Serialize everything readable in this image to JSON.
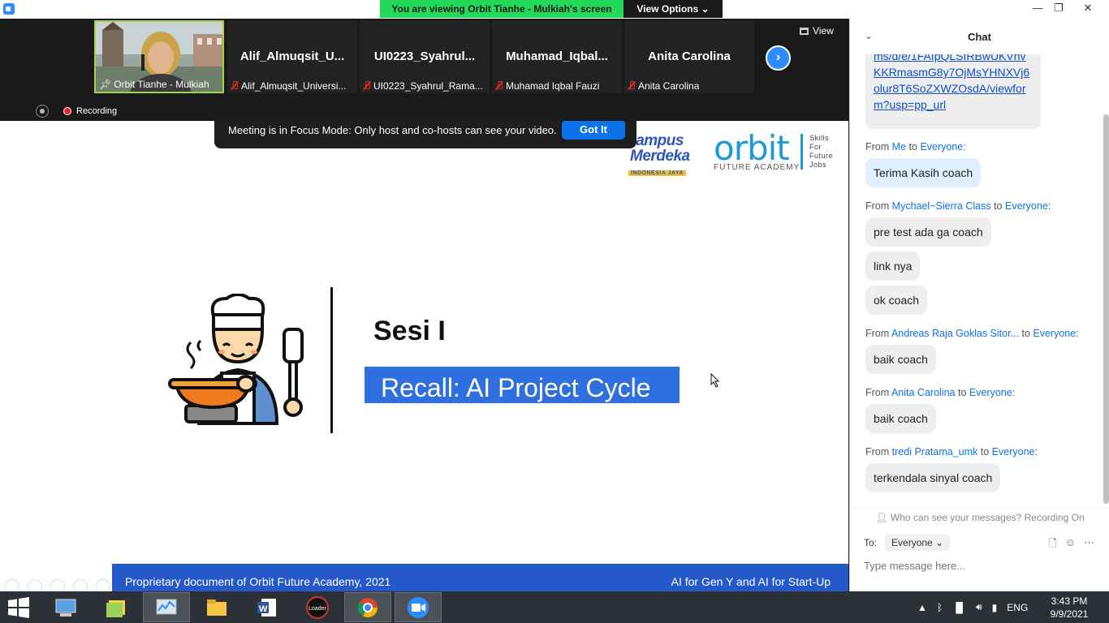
{
  "titlebar": {
    "viewing_banner": "You are viewing Orbit Tianhe - Mulkiah's screen",
    "view_options": "View Options",
    "minimize": "—",
    "restore": "❐",
    "close": "✕"
  },
  "strip": {
    "view_label": "View",
    "recording_label": "Recording",
    "participants": [
      {
        "label": "Orbit Tianhe - Mulkiah",
        "name": ""
      },
      {
        "label": "Alif_Almuqsit_Universi...",
        "name": "Alif_Almuqsit_U..."
      },
      {
        "label": "UI0223_Syahrul_Rama...",
        "name": "UI0223_Syahrul..."
      },
      {
        "label": "Muhamad Iqbal Fauzi",
        "name": "Muhamad_Iqbal..."
      },
      {
        "label": "Anita Carolina",
        "name": "Anita Carolina"
      }
    ]
  },
  "focus_toast": {
    "message": "Meeting is in Focus Mode: Only host and co-hosts can see your video.",
    "button": "Got It"
  },
  "slide": {
    "kampus_line1": "Kampus",
    "kampus_line2": "Merdeka",
    "kampus_line3": "INDONESIA JAYA",
    "orbit_word": "orbit",
    "orbit_sub": "FUTURE ACADEMY",
    "skills_lines": [
      "Skills",
      "For",
      "Future",
      "Jobs"
    ],
    "title": "Sesi I",
    "subtitle": "Recall: AI Project Cycle",
    "footer_left": "Proprietary document of Orbit Future Academy, 2021",
    "footer_right": "AI for Gen Y and AI for Start-Up"
  },
  "chat": {
    "title": "Chat",
    "link_text": "ms/d/e/1FAIpQLSfRBwUKVnvKKRmasmG8y7OjMsYHNXVj6olur8T6SoZXWZOsdA/viewform?usp=pp_url",
    "messages": [
      {
        "prefix": "From",
        "sender": "Me",
        "to": "to",
        "recipient": "Everyone:",
        "lines": [
          "Terima Kasih coach"
        ]
      },
      {
        "prefix": "From",
        "sender": "Mychael~Sierra Class",
        "to": "to",
        "recipient": "Everyone:",
        "lines": [
          "pre test ada ga coach",
          "link nya",
          "ok coach"
        ]
      },
      {
        "prefix": "From",
        "sender": "Andreas Raja Goklas Sitor...",
        "to": "to",
        "recipient": "Everyone:",
        "lines": [
          "baik coach"
        ]
      },
      {
        "prefix": "From",
        "sender": "Anita Carolina",
        "to": "to",
        "recipient": "Everyone:",
        "lines": [
          "baik coach"
        ]
      },
      {
        "prefix": "From",
        "sender": "tredi Pratama_umk",
        "to": "to",
        "recipient": "Everyone:",
        "lines": [
          "terkendala sinyal coach"
        ]
      }
    ],
    "who_can_see": "Who can see your messages? Recording On",
    "to_label": "To:",
    "to_value": "Everyone",
    "input_placeholder": "Type message here..."
  },
  "taskbar": {
    "lang": "ENG",
    "time": "3:43 PM",
    "date": "9/9/2021",
    "loader_label": "Loader"
  },
  "colors": {
    "zoom_blue": "#2d8cff",
    "banner_green": "#23d959",
    "slide_blue": "#2f6fe0",
    "footer_blue": "#2558c8"
  }
}
